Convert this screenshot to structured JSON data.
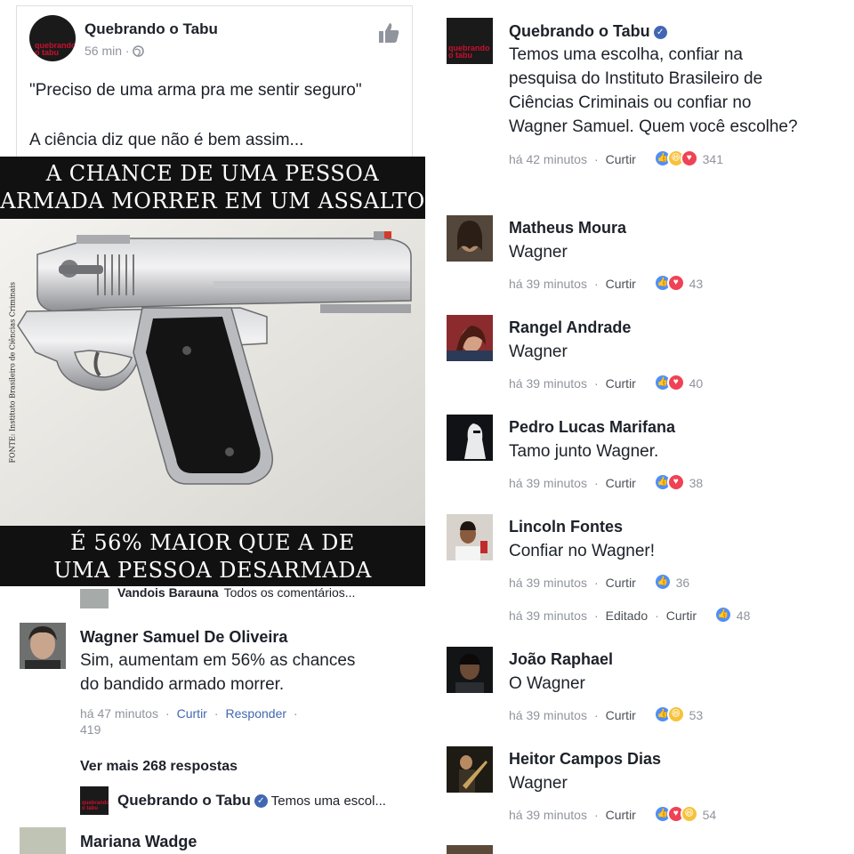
{
  "post": {
    "page_name": "Quebrando o Tabu",
    "time": "56 min",
    "separator": "·",
    "text1": "\"Preciso de uma arma pra me sentir seguro\"",
    "text2": "A ciência diz que não é bem assim...",
    "avatar_text": "quebrando o tabu",
    "meme": {
      "top_line1": "A CHANCE DE UMA PESSOA",
      "top_line2": "ARMADA MORRER EM UM ASSALTO",
      "bottom_line1": "É 56% MAIOR QUE A DE",
      "bottom_line2": "UMA PESSOA DESARMADA",
      "source": "FONTE: Instituto Brasileiro de Ciências Criminais"
    }
  },
  "left_comments": {
    "cut_row": {
      "name": "Vandois Barauna",
      "text": "Todos os comentários..."
    },
    "wagner": {
      "name": "Wagner Samuel De Oliveira",
      "text_line1": "Sim, aumentam em 56% as chances",
      "text_line2": "do bandido armado morrer.",
      "time": "há 47 minutos",
      "action1": "Curtir",
      "action2": "Responder",
      "likes": "419"
    },
    "more_replies": "Ver mais 268 respostas",
    "reply_preview": {
      "name": "Quebrando o Tabu",
      "text": "Temos uma escol..."
    },
    "mariana": {
      "name": "Mariana Wadge"
    }
  },
  "right_comments": {
    "qt": {
      "name": "Quebrando o Tabu",
      "lines": [
        "Temos uma escolha, confiar na",
        "pesquisa do Instituto Brasileiro de",
        "Ciências Criminais ou confiar no",
        "Wagner Samuel. Quem você escolhe?"
      ],
      "time": "há 42 minutos",
      "action": "Curtir",
      "count": "341"
    },
    "items": [
      {
        "name": "Matheus Moura",
        "text": "Wagner",
        "time": "há 39 minutos",
        "action": "Curtir",
        "count": "43",
        "reactions": [
          "like",
          "love"
        ]
      },
      {
        "name": "Rangel Andrade",
        "text": "Wagner",
        "time": "há 39 minutos",
        "action": "Curtir",
        "count": "40",
        "reactions": [
          "like",
          "love"
        ]
      },
      {
        "name": "Pedro Lucas Marifana",
        "text": "Tamo junto Wagner.",
        "time": "há 39 minutos",
        "action": "Curtir",
        "count": "38",
        "reactions": [
          "like",
          "love"
        ]
      },
      {
        "name": "Lincoln Fontes",
        "text": "Confiar no Wagner!",
        "time": "há 39 minutos",
        "action": "Curtir",
        "count": "36",
        "reactions": [
          "like"
        ]
      },
      {
        "name": "João Raphael",
        "text": "O Wagner",
        "time": "há 39 minutos",
        "action": "Curtir",
        "count": "53",
        "reactions": [
          "like",
          "haha"
        ]
      },
      {
        "name": "Heitor Campos Dias",
        "text": "Wagner",
        "time": "há 39 minutos",
        "action": "Curtir",
        "count": "54",
        "reactions": [
          "like",
          "love",
          "haha"
        ]
      }
    ],
    "edited_row": {
      "time": "há 39 minutos",
      "edited": "Editado",
      "action": "Curtir",
      "count": "48"
    }
  },
  "colors": {
    "link_blue": "#4267b2",
    "meta_gray": "#90949c",
    "like_blue": "#4f8ff7",
    "love_red": "#f04255",
    "haha_yellow": "#f7c23a"
  }
}
